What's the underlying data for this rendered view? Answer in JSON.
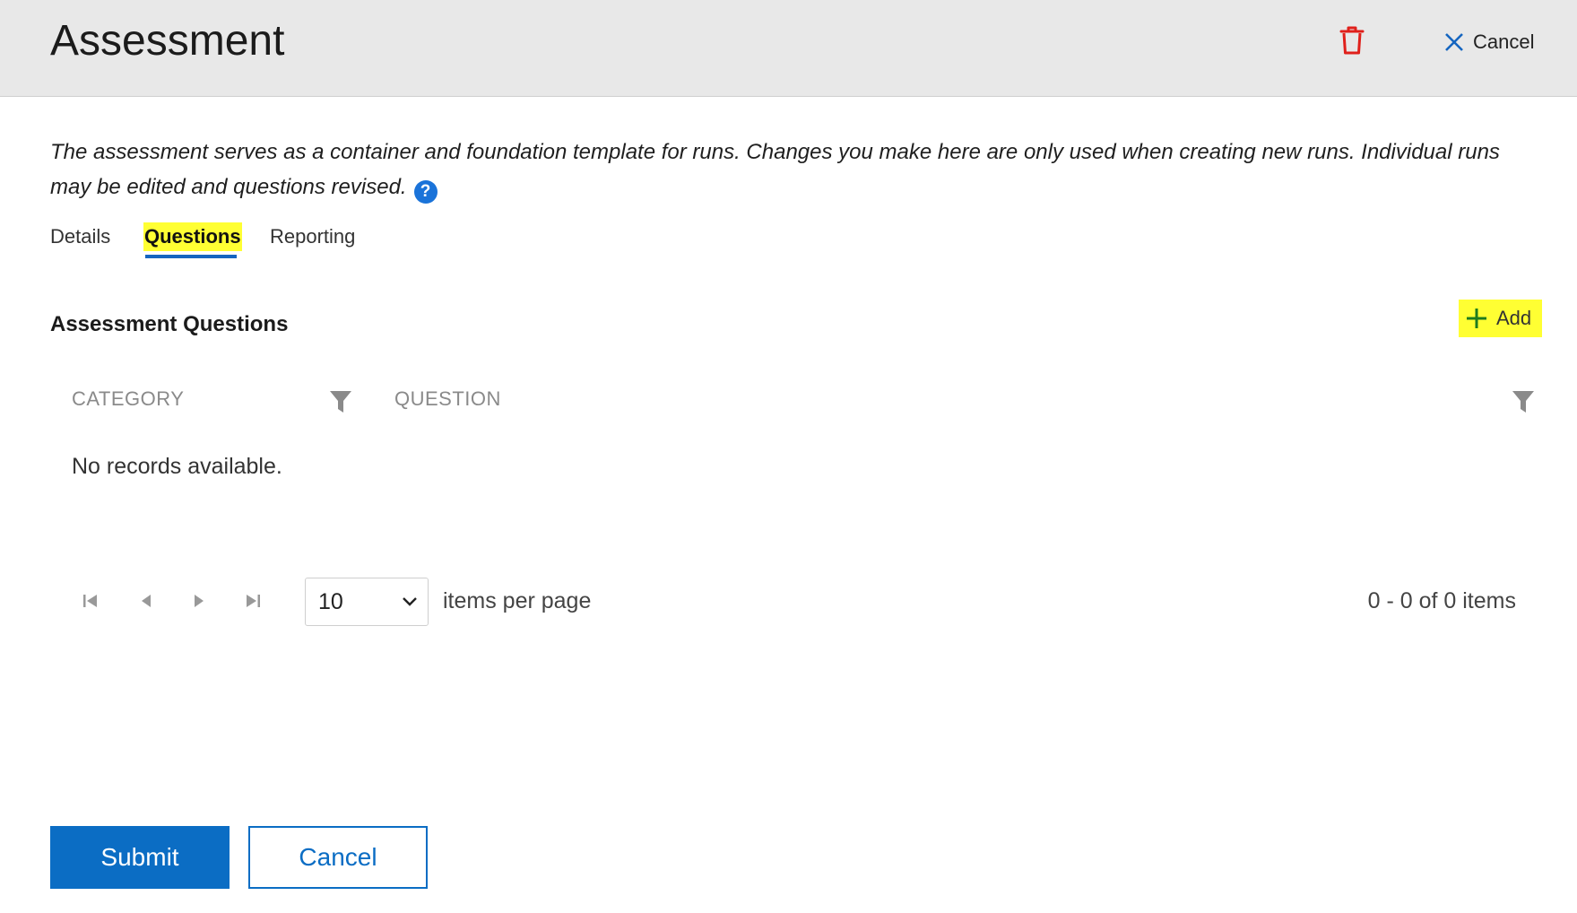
{
  "header": {
    "title": "Assessment",
    "delete_icon": "trash-icon",
    "cancel_label": "Cancel",
    "cancel_icon": "close-icon"
  },
  "description": "The assessment serves as a container and foundation template for runs. Changes you make here are only used when creating new runs. Individual runs may be edited and questions revised.",
  "help_icon": "?",
  "tabs": [
    {
      "label": "Details",
      "active": false
    },
    {
      "label": "Questions",
      "active": true
    },
    {
      "label": "Reporting",
      "active": false
    }
  ],
  "section": {
    "title": "Assessment Questions",
    "add_label": "Add"
  },
  "grid": {
    "columns": [
      "CATEGORY",
      "QUESTION"
    ],
    "empty_text": "No records available."
  },
  "pager": {
    "page_size": "10",
    "items_per_page_label": "items per page",
    "range_text": "0 - 0 of 0 items"
  },
  "footer": {
    "submit_label": "Submit",
    "cancel_label": "Cancel"
  },
  "colors": {
    "accent": "#0b6dc4",
    "highlight": "#ffff33",
    "danger": "#e0201b",
    "header_bg": "#e8e8e8"
  }
}
